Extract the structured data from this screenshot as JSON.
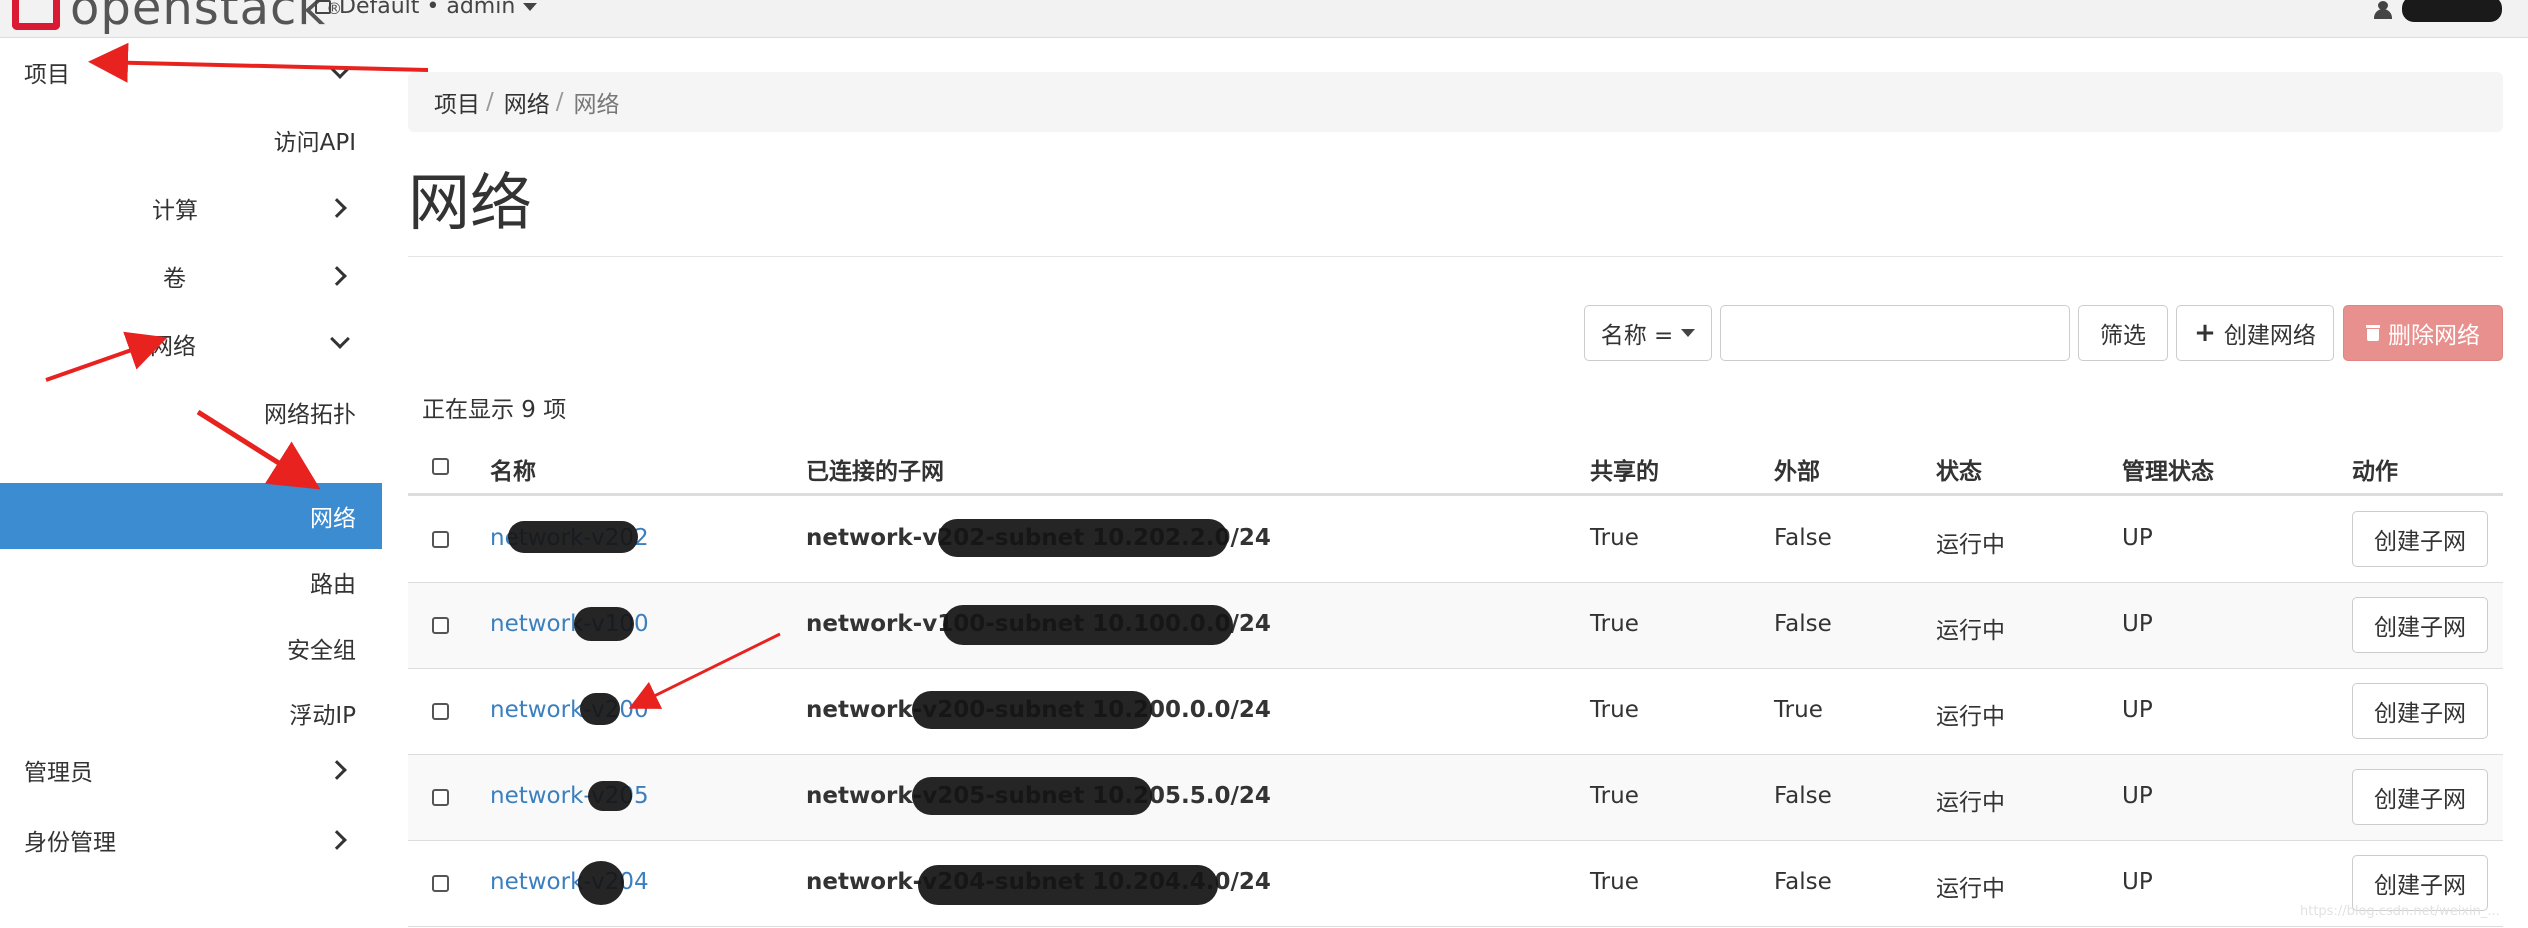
{
  "header": {
    "logo_text": "openstack",
    "logo_reg": "®",
    "domain_project": "Default • admin"
  },
  "sidebar": {
    "project": "项目",
    "access_api": "访问API",
    "compute": "计算",
    "volumes": "卷",
    "network": "网络",
    "network_topology": "网络拓扑",
    "networks": "网络",
    "routers": "路由",
    "security_groups": "安全组",
    "floating_ip": "浮动IP",
    "admin": "管理员",
    "identity": "身份管理"
  },
  "breadcrumb": {
    "level1": "项目",
    "level2": "网络",
    "current": "网络",
    "sep": "/"
  },
  "page_title": "网络",
  "toolbar": {
    "filter_field": "名称 =",
    "filter_value": "",
    "filter_button": "筛选",
    "create_button": "创建网络",
    "delete_button": "删除网络"
  },
  "table": {
    "count_text": "正在显示 9 项",
    "columns": {
      "name": "名称",
      "subnets": "已连接的子网",
      "shared": "共享的",
      "external": "外部",
      "status": "状态",
      "admin_state": "管理状态",
      "actions": "动作"
    },
    "rows": [
      {
        "name": "network-v202",
        "subnet": "network-v202-subnet 10.202.2.0/24",
        "shared": "True",
        "external": "False",
        "status": "运行中",
        "admin_state": "UP",
        "action": "创建子网"
      },
      {
        "name": "network-v100",
        "subnet": "network-v100-subnet 10.100.0.0/24",
        "shared": "True",
        "external": "False",
        "status": "运行中",
        "admin_state": "UP",
        "action": "创建子网"
      },
      {
        "name": "network-v200",
        "subnet": "network-v200-subnet 10.200.0.0/24",
        "shared": "True",
        "external": "True",
        "status": "运行中",
        "admin_state": "UP",
        "action": "创建子网"
      },
      {
        "name": "network-v205",
        "subnet": "network-v205-subnet 10.205.5.0/24",
        "shared": "True",
        "external": "False",
        "status": "运行中",
        "admin_state": "UP",
        "action": "创建子网"
      },
      {
        "name": "network-v204",
        "subnet": "network-v204-subnet 10.204.4.0/24",
        "shared": "True",
        "external": "False",
        "status": "运行中",
        "admin_state": "UP",
        "action": "创建子网"
      }
    ]
  },
  "watermark": "https://blog.csdn.net/weixin_..."
}
